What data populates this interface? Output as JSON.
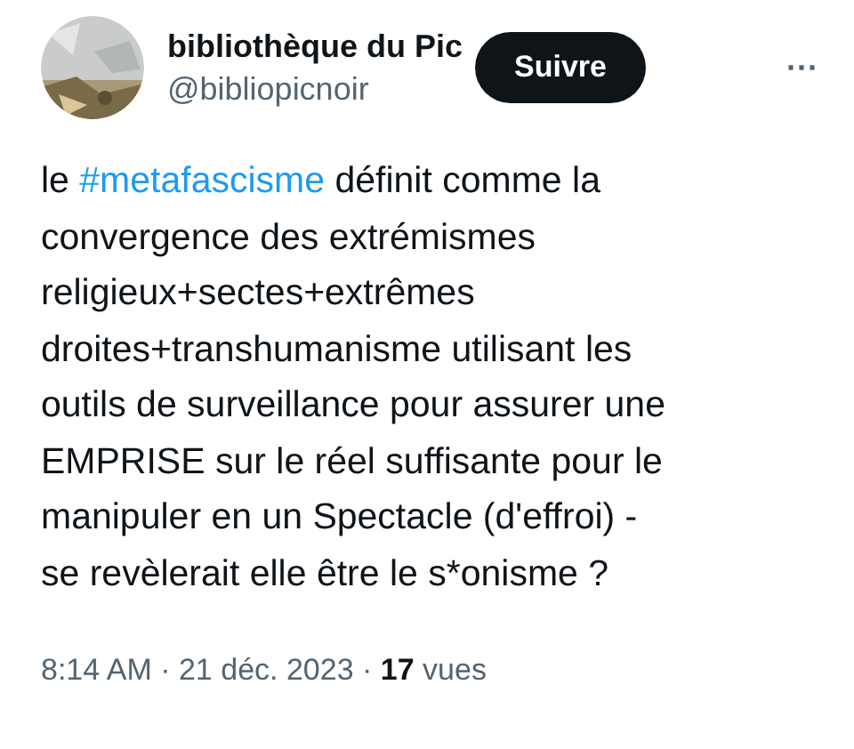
{
  "author": {
    "name": "bibliothèque du Pic",
    "handle": "@bibliopicnoir"
  },
  "follow_button": "Suivre",
  "more_button": "···",
  "body": {
    "before": "le ",
    "hashtag": "#metafascisme",
    "after": " définit comme la",
    "lines": [
      "convergence des extrémismes",
      "religieux+sectes+extrêmes",
      "droites+transhumanisme utilisant les",
      "outils de surveillance pour assurer une",
      "EMPRISE sur le réel suffisante pour le",
      "manipuler en un Spectacle (d'effroi) -",
      "se revèlerait elle être le s*onisme ?"
    ]
  },
  "meta": "8:14 AM · 21 déc. 2023 · **17** vues"
}
